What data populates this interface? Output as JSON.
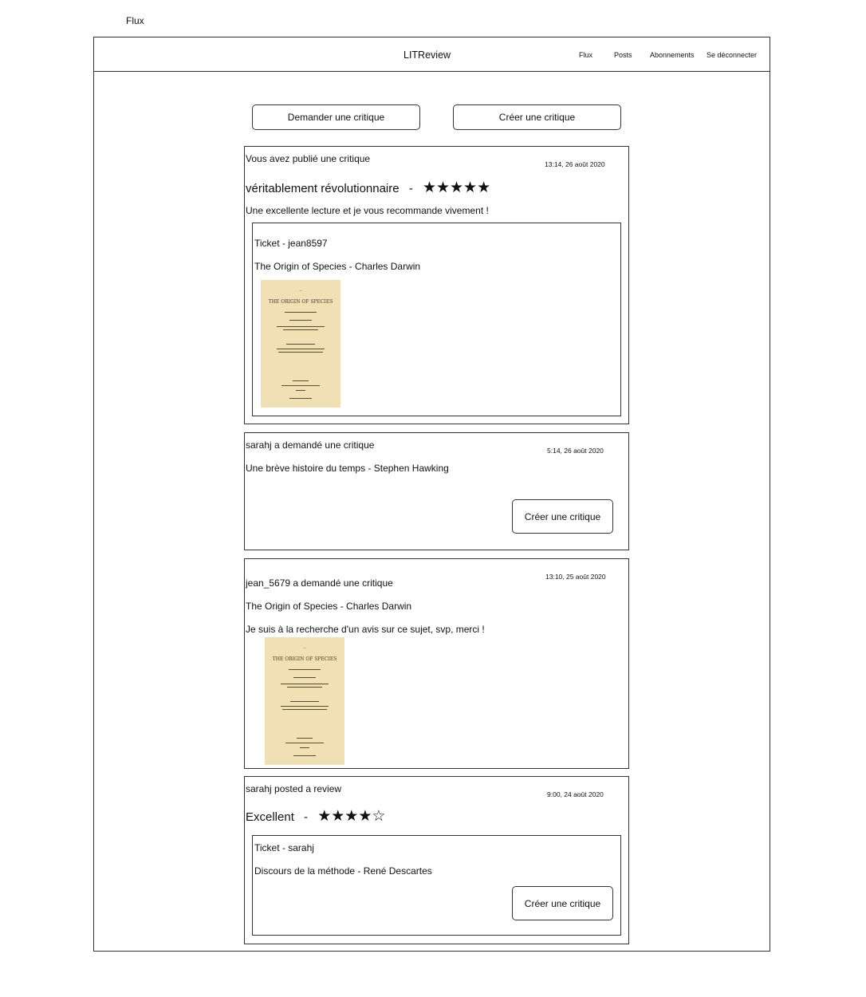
{
  "page_label": "Flux",
  "header": {
    "title": "LITReview",
    "nav": [
      "Flux",
      "Posts",
      "Abonnements",
      "Se déconnecter"
    ]
  },
  "actions": {
    "request_review": "Demander une critique",
    "create_review": "Créer une critique"
  },
  "feed": {
    "item1": {
      "heading": "Vous avez publié une critique",
      "timestamp": "13:14, 26 août 2020",
      "headline": "véritablement révolutionnaire",
      "separator": "-",
      "stars": "★★★★★",
      "body": "Une excellente lecture et je vous recommande vivement !",
      "ticket": {
        "heading": "Ticket - jean8597",
        "book": "The Origin of Species - Charles Darwin",
        "cover_title": "THE ORIGIN OF SPECIES"
      }
    },
    "item2": {
      "heading": "sarahj a demandé une critique",
      "timestamp": "5:14, 26 août 2020",
      "book": "Une brève histoire du temps - Stephen Hawking",
      "button": "Créer une critique"
    },
    "item3": {
      "heading": "jean_5679 a demandé une critique",
      "timestamp": "13:10, 25 août 2020",
      "book": "The Origin of Species - Charles Darwin",
      "body": "Je suis à la recherche d'un avis sur ce sujet, svp, merci !",
      "cover_title": "THE ORIGIN OF SPECIES"
    },
    "item4": {
      "heading": "sarahj posted a review",
      "timestamp": "9:00, 24 août 2020",
      "headline": "Excellent",
      "separator": "-",
      "stars": "★★★★☆",
      "ticket": {
        "heading": "Ticket - sarahj",
        "book": "Discours de la méthode - René Descartes",
        "button": "Créer une critique"
      }
    }
  }
}
